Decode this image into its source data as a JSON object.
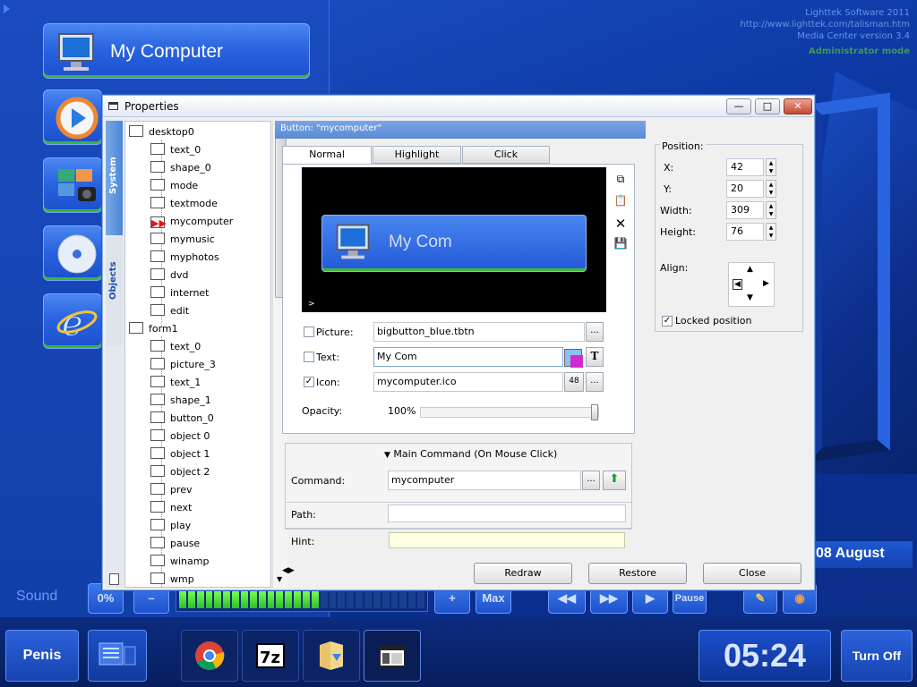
{
  "desktop": {
    "info_lines": [
      "Lighttek Software 2011",
      "http://www.lighttek.com/talisman.htm",
      "Media Center version 3.4"
    ],
    "admin_mode": "Administrator mode",
    "main_button_label": "My Computer",
    "date": "08 August"
  },
  "sound_bar": {
    "label": "Sound",
    "percent": "0%",
    "minus": "–",
    "plus": "+",
    "max": "Max",
    "pause": "Pause",
    "volume_level_segments_on": 16,
    "volume_level_segments_total": 28
  },
  "taskbar": {
    "start_label": "Penis",
    "clock": "05:24",
    "turn_off": "Turn Off",
    "apps": [
      "chrome-icon",
      "7zip-icon",
      "folder-icon",
      "window-icon"
    ]
  },
  "dialog": {
    "title": "Properties",
    "vertical_tabs": [
      "System",
      "Objects"
    ],
    "tree": [
      {
        "label": "desktop0",
        "icon": "desk",
        "level": 0
      },
      {
        "label": "text_0",
        "icon": "doc",
        "level": 1
      },
      {
        "label": "shape_0",
        "icon": "shape",
        "level": 1
      },
      {
        "label": "mode",
        "icon": "obj",
        "level": 1
      },
      {
        "label": "textmode",
        "icon": "doc",
        "level": 1
      },
      {
        "label": "mycomputer",
        "icon": "arrow",
        "level": 1,
        "selected": true
      },
      {
        "label": "mymusic",
        "icon": "obj",
        "level": 1
      },
      {
        "label": "myphotos",
        "icon": "obj",
        "level": 1
      },
      {
        "label": "dvd",
        "icon": "obj",
        "level": 1
      },
      {
        "label": "internet",
        "icon": "obj",
        "level": 1
      },
      {
        "label": "edit",
        "icon": "obj",
        "level": 1
      },
      {
        "label": "form1",
        "icon": "form",
        "level": 0
      },
      {
        "label": "text_0",
        "icon": "doc",
        "level": 1
      },
      {
        "label": "picture_3",
        "icon": "pic",
        "level": 1
      },
      {
        "label": "text_1",
        "icon": "doc",
        "level": 1
      },
      {
        "label": "shape_1",
        "icon": "shape",
        "level": 1
      },
      {
        "label": "button_0",
        "icon": "obj",
        "level": 1
      },
      {
        "label": "object 0",
        "icon": "obj",
        "level": 1
      },
      {
        "label": "object 1",
        "icon": "obj",
        "level": 1
      },
      {
        "label": "object 2",
        "icon": "obj",
        "level": 1
      },
      {
        "label": "prev",
        "icon": "obj",
        "level": 1
      },
      {
        "label": "next",
        "icon": "obj",
        "level": 1
      },
      {
        "label": "play",
        "icon": "obj",
        "level": 1
      },
      {
        "label": "pause",
        "icon": "obj",
        "level": 1
      },
      {
        "label": "winamp",
        "icon": "obj",
        "level": 1
      },
      {
        "label": "wmp",
        "icon": "obj",
        "level": 1
      }
    ],
    "header": "Button: \"mycomputer\"",
    "tabs": [
      "Normal",
      "Highlight",
      "Click"
    ],
    "preview_label": "My Com",
    "preview_prompt": ">",
    "picture": {
      "label": "Picture:",
      "value": "bigbutton_blue.tbtn",
      "checked": false
    },
    "text": {
      "label": "Text:",
      "value": "My Com",
      "checked": false
    },
    "icon": {
      "label": "Icon:",
      "value": "mycomputer.ico",
      "size": "48",
      "checked": true
    },
    "opacity": {
      "label": "Opacity:",
      "value": "100%",
      "level": 1.0
    },
    "main_command": "Main Command (On Mouse Click)",
    "command": {
      "label": "Command:",
      "value": "mycomputer"
    },
    "path": {
      "label": "Path:",
      "value": ""
    },
    "hint": {
      "label": "Hint:",
      "value": ""
    },
    "position": {
      "title": "Position:",
      "x_label": "X:",
      "x": "42",
      "y_label": "Y:",
      "y": "20",
      "width_label": "Width:",
      "width": "309",
      "height_label": "Height:",
      "height": "76",
      "align_label": "Align:",
      "locked_label": "Locked position",
      "locked": true
    },
    "buttons": {
      "redraw": "Redraw",
      "restore": "Restore",
      "close": "Close"
    },
    "ellipsis": "...",
    "T": "T"
  },
  "colors": {
    "accent": "#2a64e0",
    "selection_red": "#e11111",
    "hint_bg": "#ffffe2"
  }
}
